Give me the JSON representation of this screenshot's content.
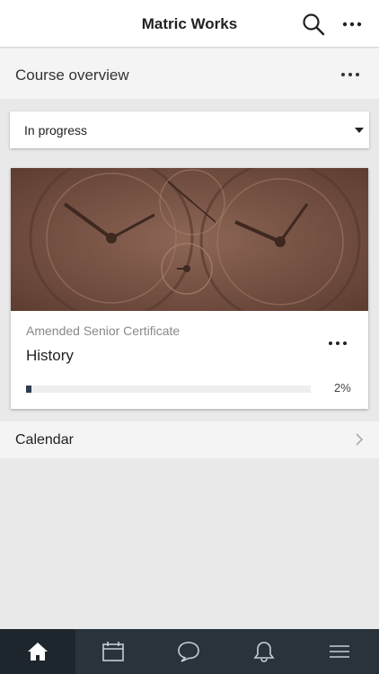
{
  "header": {
    "title": "Matric Works",
    "icons": [
      "search-icon",
      "more-icon"
    ]
  },
  "course_overview": {
    "label": "Course overview",
    "filter": {
      "selected": "In progress"
    },
    "courses": [
      {
        "category": "Amended Senior Certificate",
        "name": "History",
        "progress_percent": 2,
        "progress_label": "2%",
        "image": "clock-faces-sepia"
      }
    ]
  },
  "calendar": {
    "label": "Calendar"
  },
  "bottom_nav": {
    "items": [
      {
        "icon": "home-icon",
        "active": true
      },
      {
        "icon": "calendar-icon",
        "active": false
      },
      {
        "icon": "messages-icon",
        "active": false
      },
      {
        "icon": "bell-icon",
        "active": false
      },
      {
        "icon": "menu-icon",
        "active": false
      }
    ]
  },
  "colors": {
    "accent": "#2c3e4f",
    "nav_bg": "#29333c",
    "image_tint": "#7a5445"
  }
}
